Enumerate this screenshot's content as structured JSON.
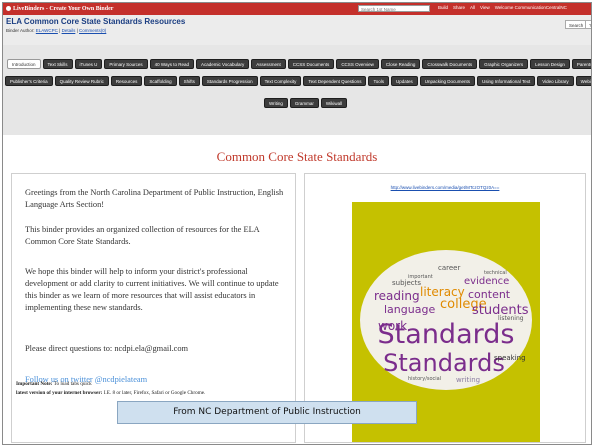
{
  "app": {
    "brand": "LiveBinders - Create Your Own Binder",
    "search_placeholder": "Search 1st Name",
    "topnav": [
      "Build",
      "Share",
      "All",
      "View",
      "Welcome CommunicationCentralNC"
    ]
  },
  "binder": {
    "title": "ELA Common Core State Standards Resources",
    "meta_prefix": "Binder Author:",
    "author": "ELAWCPC",
    "details": "Details",
    "comments": "Comments(0)",
    "buttons": [
      "Search",
      "?"
    ]
  },
  "tabs": {
    "row1": [
      "Introduction",
      "Text Skills",
      "iTunes U",
      "Primary Sources",
      "40 Ways to Read",
      "Academic Vocabulary",
      "Assessment",
      "CCSS Documents",
      "CCSS Overview",
      "Close Reading",
      "Crosswalk Documents",
      "Graphic Organizers",
      "Lesson Design",
      "Parents"
    ],
    "row2": [
      "Publisher's Criteria",
      "Quality Review Rubric",
      "Resources",
      "Scaffolding",
      "Shifts",
      "Standards Progression",
      "Text Complexity",
      "Text Dependent Questions",
      "Tools",
      "Updates",
      "Unpacking Documents",
      "Using Informational Text",
      "Video Library",
      "Webinars"
    ],
    "row3": [
      "Writing",
      "Grammar",
      "Wikiwall"
    ]
  },
  "content": {
    "title": "Common Core State Standards",
    "paragraphs": [
      "Greetings from the North Carolina Department of Public Instruction, English Language Arts Section!",
      "This binder provides an organized collection of resources for the ELA Common Core State Standards.",
      "We hope this binder will help to inform your district's professional development or add clarity to current initiatives. We will continue to update this binder as we learn of more resources that will assist educators in implementing these new standards.",
      "Please direct questions to: ncdpi.ela@gmail.com"
    ],
    "follow_link": "Follow us on twitter @ncdpielateam",
    "note_bold": "Important Note:",
    "note_text": " To load tabs quick",
    "note_line2_bold": "latest version of your internet browser:",
    "note_line2": " I.E. 8 or later, Firefox, Safari or Google Chrome."
  },
  "wordcloud": {
    "link": "http://www.livebinders.com/media/get/MTczOTQz0A==",
    "background": "#c5c100",
    "words": [
      "Standards",
      "Standards",
      "language",
      "college",
      "students",
      "reading",
      "literacy",
      "content",
      "evidence",
      "work",
      "writing",
      "speaking",
      "listening",
      "career",
      "technical",
      "subjects",
      "important",
      "history/social"
    ]
  },
  "caption": "From NC Department of Public Instruction"
}
